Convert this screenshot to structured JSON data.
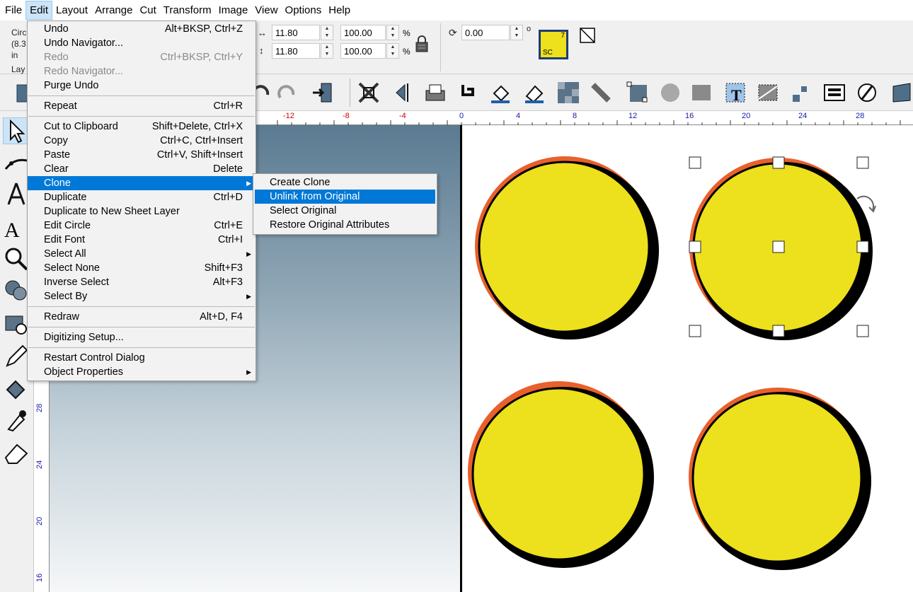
{
  "menubar": [
    "File",
    "Edit",
    "Layout",
    "Arrange",
    "Cut",
    "Transform",
    "Image",
    "View",
    "Options",
    "Help"
  ],
  "propbar": {
    "info_lines": [
      "Circ",
      "(8.3",
      "in",
      "Lay"
    ],
    "width_value": "11.80",
    "height_value": "11.80",
    "width_pct": "100.00",
    "height_pct": "100.00",
    "pct_symbol": "%",
    "rotation_value": "0.00",
    "degree_symbol": "o",
    "color_swatch_number": "7",
    "color_swatch_label": "SC",
    "swatch_color": "#ede01c"
  },
  "ruler_h": [
    "-12",
    "-8",
    "-4",
    "0",
    "4",
    "8",
    "12",
    "16",
    "20",
    "24",
    "28"
  ],
  "ruler_v": [
    "28",
    "24",
    "20",
    "16"
  ],
  "edit_menu": {
    "items": [
      {
        "label": "Undo",
        "shortcut": "Alt+BKSP, Ctrl+Z",
        "disabled": false
      },
      {
        "label": "Undo Navigator...",
        "shortcut": "",
        "disabled": false
      },
      {
        "label": "Redo",
        "shortcut": "Ctrl+BKSP, Ctrl+Y",
        "disabled": true
      },
      {
        "label": "Redo Navigator...",
        "shortcut": "",
        "disabled": true
      },
      {
        "label": "Purge Undo",
        "shortcut": "",
        "disabled": false
      },
      {
        "label": "Repeat",
        "shortcut": "Ctrl+R",
        "disabled": false
      },
      {
        "label": "Cut to Clipboard",
        "shortcut": "Shift+Delete, Ctrl+X",
        "disabled": false
      },
      {
        "label": "Copy",
        "shortcut": "Ctrl+C, Ctrl+Insert",
        "disabled": false
      },
      {
        "label": "Paste",
        "shortcut": "Ctrl+V, Shift+Insert",
        "disabled": false
      },
      {
        "label": "Clear",
        "shortcut": "Delete",
        "disabled": false
      },
      {
        "label": "Clone",
        "shortcut": "",
        "disabled": false
      },
      {
        "label": "Duplicate",
        "shortcut": "Ctrl+D",
        "disabled": false
      },
      {
        "label": "Duplicate to New Sheet Layer",
        "shortcut": "",
        "disabled": false
      },
      {
        "label": "Edit Circle",
        "shortcut": "Ctrl+E",
        "disabled": false
      },
      {
        "label": "Edit Font",
        "shortcut": "Ctrl+I",
        "disabled": false
      },
      {
        "label": "Select All",
        "shortcut": "",
        "disabled": false
      },
      {
        "label": "Select None",
        "shortcut": "Shift+F3",
        "disabled": false
      },
      {
        "label": "Inverse Select",
        "shortcut": "Alt+F3",
        "disabled": false
      },
      {
        "label": "Select By",
        "shortcut": "",
        "disabled": false
      },
      {
        "label": "Redraw",
        "shortcut": "Alt+D, F4",
        "disabled": false
      },
      {
        "label": "Digitizing Setup...",
        "shortcut": "",
        "disabled": false
      },
      {
        "label": "Restart Control Dialog",
        "shortcut": "",
        "disabled": false
      },
      {
        "label": "Object Properties",
        "shortcut": "",
        "disabled": false
      }
    ]
  },
  "clone_submenu": {
    "items": [
      {
        "label": "Create Clone"
      },
      {
        "label": "Unlink from Original"
      },
      {
        "label": "Select Original"
      },
      {
        "label": "Restore Original Attributes"
      }
    ]
  },
  "colors": {
    "circle_fill": "#ede01c",
    "circle_outline": "#000000",
    "circle_shadow_orange": "#e8602c",
    "menu_highlight": "#0078d7"
  }
}
